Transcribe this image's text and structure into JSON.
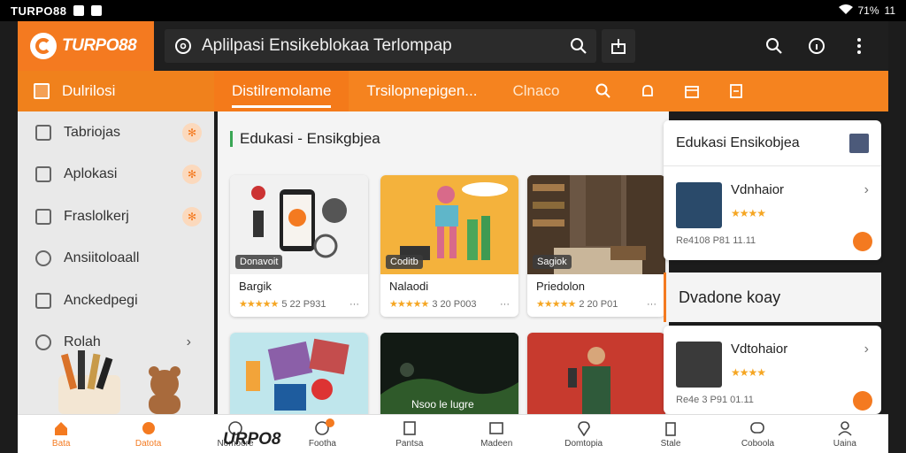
{
  "status_bar": {
    "carrier": "TURPO88",
    "battery": "71%",
    "time": "11"
  },
  "app": {
    "logo": "TURPO88",
    "search_text": "Aplilpasi Ensikeblokaa Terlompap"
  },
  "nav": {
    "side_header": "Dulrilosi",
    "tabs": [
      "Distilremolame",
      "Trsilopnepigen...",
      "Clnaco"
    ]
  },
  "sidebar": {
    "items": [
      {
        "label": "Tabriojas",
        "icon": "mail-icon"
      },
      {
        "label": "Aplokasi",
        "icon": "book-icon"
      },
      {
        "label": "Fraslolkerj",
        "icon": "tag-icon"
      },
      {
        "label": "Ansiitoloaall",
        "icon": "search-icon"
      },
      {
        "label": "Anckedpegi",
        "icon": "edit-icon"
      },
      {
        "label": "Rolah",
        "icon": "check-circle-icon"
      }
    ]
  },
  "main": {
    "section_title": "Edukasi - Ensikgbjea",
    "cards": [
      {
        "tag": "Donavoit",
        "name": "Bargik",
        "rating": "5 22 P931"
      },
      {
        "tag": "Coditb",
        "name": "Nalaodi",
        "rating": "3 20 P003"
      },
      {
        "tag": "Sagiok",
        "name": "Priedolon",
        "rating": "2 20 P01"
      },
      {
        "tag": "",
        "name": "",
        "rating": ""
      },
      {
        "tag": "Nsoo le lugre",
        "name": "",
        "rating": ""
      },
      {
        "tag": "",
        "name": "",
        "rating": ""
      }
    ]
  },
  "right_panel": {
    "header": "Edukasi Ensikobjea",
    "items": [
      {
        "title": "Vdnhaior",
        "date": "Re4108 P81 11.11"
      },
      {
        "title": "Vdtohaior",
        "date": "Re4e 3 P91 01.11"
      }
    ],
    "section": "Dvadone koay"
  },
  "bottom_nav": {
    "wordmark": "URPO8",
    "items": [
      "Bata",
      "Datota",
      "Nomoore",
      "Footha",
      "Pantsa",
      "Madeen",
      "Domtopia",
      "Stale",
      "Coboola",
      "Uaina"
    ]
  },
  "colors": {
    "brand_orange": "#f47a20",
    "star": "#f5a623"
  }
}
